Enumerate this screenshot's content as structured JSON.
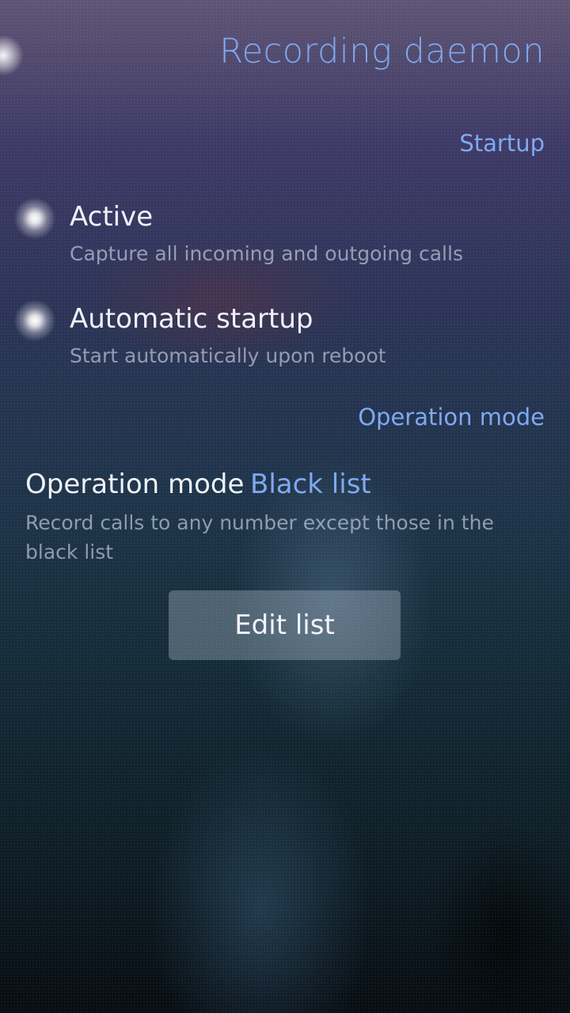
{
  "page": {
    "title": "Recording daemon"
  },
  "sections": {
    "startup": "Startup",
    "operation_mode": "Operation mode"
  },
  "switches": [
    {
      "label": "Active",
      "description": "Capture all incoming and outgoing calls",
      "checked": true
    },
    {
      "label": "Automatic startup",
      "description": "Start automatically upon reboot",
      "checked": true
    }
  ],
  "operation_mode": {
    "label": "Operation mode",
    "value": "Black list",
    "description": "Record calls to any number except those in the black list"
  },
  "edit_list_button": {
    "label": "Edit list"
  },
  "colors": {
    "accent": "#7fa9f2",
    "primary_text": "#eef2f8",
    "secondary_text": "#aab4c3"
  }
}
